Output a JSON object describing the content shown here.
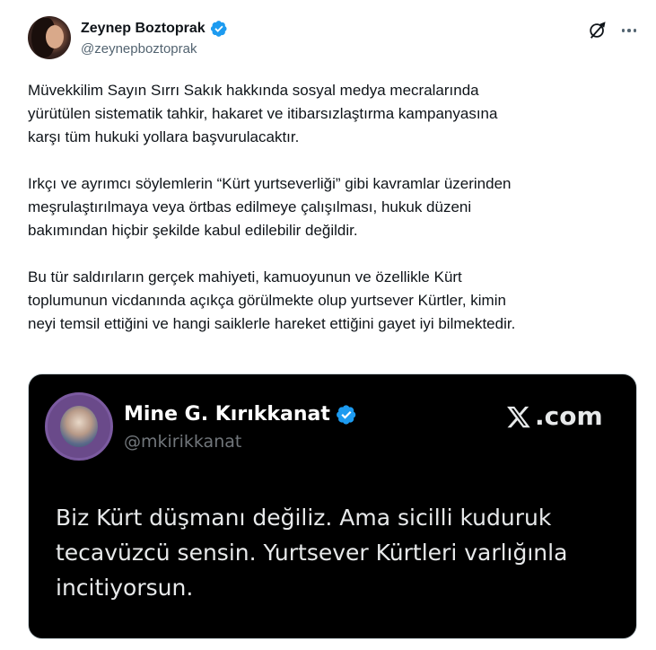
{
  "author": {
    "display_name": "Zeynep Boztoprak",
    "handle": "@zeynepboztoprak",
    "verified": true,
    "verified_color": "#1d9bf0"
  },
  "actions": {
    "grok_icon": "grok-icon",
    "more_icon": "more-icon"
  },
  "post": {
    "paragraphs": [
      "Müvekkilim Sayın Sırrı Sakık hakkında sosyal medya mecralarında\nyürütülen sistematik tahkir, hakaret ve itibarsızlaştırma kampanyasına\nkarşı tüm hukuki yollara başvurulacaktır.",
      "Irkçı ve ayrımcı söylemlerin “Kürt yurtseverliği” gibi kavramlar üzerinden\nmeşrulaştırılmaya veya örtbas edilmeye çalışılması, hukuk düzeni\nbakımından hiçbir şekilde kabul edilebilir değildir.",
      "Bu tür saldırıların gerçek mahiyeti, kamuoyunun ve özellikle Kürt\ntoplumunun vicdanında açıkça görülmekte olup yurtsever Kürtler, kimin\nneyi temsil ettiğini ve hangi saiklerle hareket ettiğini gayet iyi bilmektedir."
    ]
  },
  "media": {
    "quoted_name": "Mine G. Kırıkkanat",
    "quoted_handle": "@mkirikkanat",
    "watermark": ".com",
    "quoted_text": "Biz Kürt düşmanı değiliz. Ama sicilli kuduruk\ntecavüzcü sensin. Yurtsever Kürtleri varlığınla\nincitiyorsun.",
    "background_color": "#000000"
  }
}
